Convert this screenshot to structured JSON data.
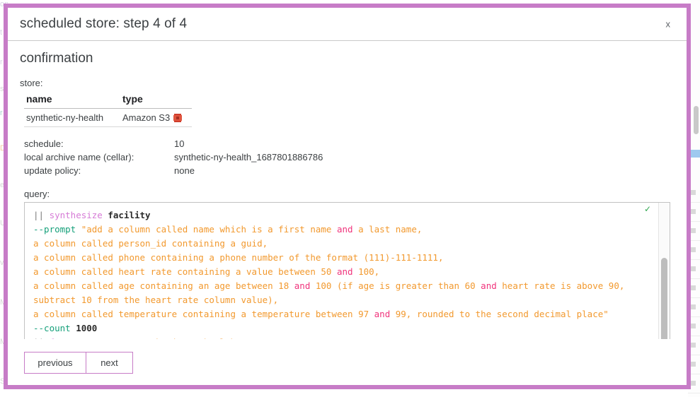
{
  "modal": {
    "title": "scheduled store: step 4 of 4",
    "close_label": "x",
    "section_title": "confirmation"
  },
  "store": {
    "label": "store:",
    "columns": [
      "name",
      "type"
    ],
    "rows": [
      {
        "name": "synthetic-ny-health",
        "type": "Amazon S3",
        "type_icon": "amazon-s3-icon"
      }
    ]
  },
  "details": [
    {
      "key": "schedule:",
      "value": "10"
    },
    {
      "key": "local archive name (cellar):",
      "value": "synthetic-ny-health_1687801886786"
    },
    {
      "key": "update policy:",
      "value": "none"
    }
  ],
  "query": {
    "label": "query:",
    "valid_icon": "green-check-icon",
    "lines": [
      {
        "segments": [
          {
            "t": "|| ",
            "c": "tok-pipe"
          },
          {
            "t": "synthesize ",
            "c": "tok-verb"
          },
          {
            "t": "facility",
            "c": "tok-ident"
          }
        ]
      },
      {
        "segments": [
          {
            "t": "--prompt ",
            "c": "tok-flag"
          },
          {
            "t": "\"add a column called name which is a first name ",
            "c": "tok-str"
          },
          {
            "t": "and",
            "c": "tok-and"
          },
          {
            "t": " a last name,",
            "c": "tok-str"
          }
        ]
      },
      {
        "segments": [
          {
            "t": "a column called person_id containing a guid,",
            "c": "tok-str"
          }
        ]
      },
      {
        "segments": [
          {
            "t": "a column called phone containing a phone number of the format (111)-111-1111,",
            "c": "tok-str"
          }
        ]
      },
      {
        "segments": [
          {
            "t": "a column called heart rate containing a value between 50 ",
            "c": "tok-str"
          },
          {
            "t": "and",
            "c": "tok-and"
          },
          {
            "t": " 100,",
            "c": "tok-str"
          }
        ]
      },
      {
        "segments": [
          {
            "t": "a column called age containing an age between 18 ",
            "c": "tok-str"
          },
          {
            "t": "and",
            "c": "tok-and"
          },
          {
            "t": " 100 (if age is greater than 60 ",
            "c": "tok-str"
          },
          {
            "t": "and",
            "c": "tok-and"
          },
          {
            "t": " heart rate is above 90,",
            "c": "tok-str"
          }
        ]
      },
      {
        "segments": [
          {
            "t": "subtract 10 from the heart rate column value),",
            "c": "tok-str"
          }
        ]
      },
      {
        "segments": [
          {
            "t": "a column called temperature containing a temperature between 97 ",
            "c": "tok-str"
          },
          {
            "t": "and",
            "c": "tok-and"
          },
          {
            "t": " 99, rounded to the second decimal place\"",
            "c": "tok-str"
          }
        ]
      },
      {
        "segments": [
          {
            "t": "--count ",
            "c": "tok-flag"
          },
          {
            "t": "1000",
            "c": "tok-num"
          }
        ]
      },
      {
        "segments": [
          {
            "t": "|| ",
            "c": "tok-pipe"
          },
          {
            "t": "freeze ",
            "c": "tok-verb"
          },
          {
            "t": "--store ",
            "c": "tok-flag"
          },
          {
            "t": "\"synthetic-ny-health\"",
            "c": "tok-str"
          }
        ]
      }
    ]
  },
  "footer": {
    "previous_label": "previous",
    "next_label": "next"
  },
  "colors": {
    "modal_border": "#c77cc7",
    "string_orange": "#f2992e",
    "keyword_pink": "#f0347c",
    "flag_green": "#15a07a",
    "verb_purple": "#d67ad6",
    "check_green": "#2fa84f",
    "s3_red": "#cf3c2b"
  },
  "background_bleed": {
    "left_fragments": [
      "ons",
      "t",
      "r",
      "s",
      "r",
      "D",
      "e",
      "U",
      "v",
      "M",
      "M",
      "S"
    ],
    "right_visible": true
  }
}
